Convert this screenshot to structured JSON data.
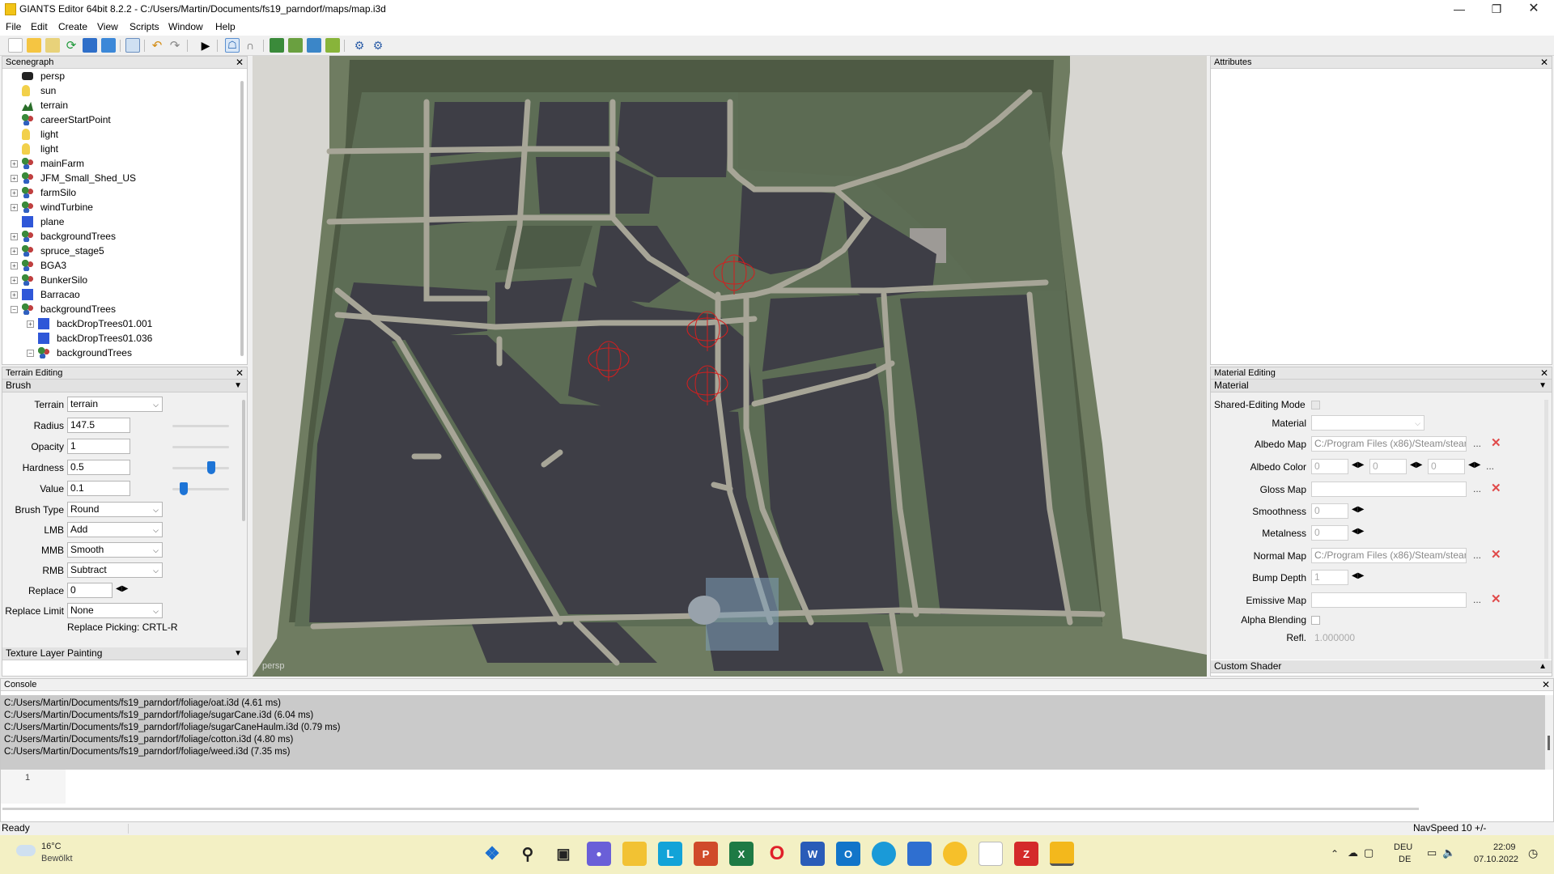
{
  "window": {
    "title": "GIANTS Editor 64bit 8.2.2 - C:/Users/Martin/Documents/fs19_parndorf/maps/map.i3d"
  },
  "menu": [
    "File",
    "Edit",
    "Create",
    "View",
    "Scripts",
    "Window",
    "Help"
  ],
  "scenegraph": {
    "title": "Scenegraph",
    "items": [
      {
        "label": "persp",
        "icon": "camera-icon"
      },
      {
        "label": "sun",
        "icon": "light-bulb-icon"
      },
      {
        "label": "terrain",
        "icon": "terrain-icon"
      },
      {
        "label": "careerStartPoint",
        "icon": "transform-group-icon"
      },
      {
        "label": "light",
        "icon": "light-bulb-icon"
      },
      {
        "label": "light",
        "icon": "light-bulb-icon"
      },
      {
        "label": "mainFarm",
        "icon": "transform-group-icon"
      },
      {
        "label": "JFM_Small_Shed_US",
        "icon": "transform-group-icon"
      },
      {
        "label": "farmSilo",
        "icon": "transform-group-icon"
      },
      {
        "label": "windTurbine",
        "icon": "transform-group-icon"
      },
      {
        "label": "plane",
        "icon": "shape-cube-icon"
      },
      {
        "label": "backgroundTrees",
        "icon": "transform-group-icon"
      },
      {
        "label": "spruce_stage5",
        "icon": "transform-group-icon"
      },
      {
        "label": "BGA3",
        "icon": "transform-group-icon"
      },
      {
        "label": "BunkerSilo",
        "icon": "transform-group-icon"
      },
      {
        "label": "Barracao",
        "icon": "shape-cube-icon"
      },
      {
        "label": "backgroundTrees",
        "icon": "transform-group-icon"
      },
      {
        "label": "backDropTrees01.001",
        "icon": "shape-cube-icon"
      },
      {
        "label": "backDropTrees01.036",
        "icon": "shape-cube-icon"
      },
      {
        "label": "backgroundTrees",
        "icon": "transform-group-icon"
      }
    ]
  },
  "terrain_editing": {
    "title": "Terrain Editing",
    "brush_section": "Brush",
    "terrain_label": "Terrain",
    "terrain_value": "terrain",
    "radius_label": "Radius",
    "radius_value": "147.5",
    "opacity_label": "Opacity",
    "opacity_value": "1",
    "hardness_label": "Hardness",
    "hardness_value": "0.5",
    "value_label": "Value",
    "value_value": "0.1",
    "brush_type_label": "Brush Type",
    "brush_type_value": "Round",
    "lmb_label": "LMB",
    "lmb_value": "Add",
    "mmb_label": "MMB",
    "mmb_value": "Smooth",
    "rmb_label": "RMB",
    "rmb_value": "Subtract",
    "replace_label": "Replace",
    "replace_value": "0",
    "replace_limit_label": "Replace Limit",
    "replace_limit_value": "None",
    "replace_picking": "Replace Picking: CRTL-R",
    "texture_section": "Texture Layer Painting"
  },
  "viewport": {
    "camera_label": "persp"
  },
  "attributes": {
    "title": "Attributes"
  },
  "material_editing": {
    "title": "Material Editing",
    "section": "Material",
    "shared_editing_label": "Shared-Editing Mode",
    "material_label": "Material",
    "albedo_map_label": "Albedo Map",
    "albedo_map_value": "C:/Program Files (x86)/Steam/stean",
    "albedo_color_label": "Albedo Color",
    "albedo_r": "0",
    "albedo_g": "0",
    "albedo_b": "0",
    "gloss_map_label": "Gloss Map",
    "smoothness_label": "Smoothness",
    "smoothness_value": "0",
    "metalness_label": "Metalness",
    "metalness_value": "0",
    "normal_map_label": "Normal Map",
    "normal_map_value": "C:/Program Files (x86)/Steam/stean",
    "bump_depth_label": "Bump Depth",
    "bump_depth_value": "1",
    "emissive_map_label": "Emissive Map",
    "alpha_blending_label": "Alpha Blending",
    "refl_label": "Refl.",
    "refl_value": "1.000000",
    "custom_shader": "Custom Shader"
  },
  "console": {
    "title": "Console",
    "lines": [
      "C:/Users/Martin/Documents/fs19_parndorf/foliage/oat.i3d (4.61 ms)",
      "C:/Users/Martin/Documents/fs19_parndorf/foliage/sugarCane.i3d (6.04 ms)",
      "C:/Users/Martin/Documents/fs19_parndorf/foliage/sugarCaneHaulm.i3d (0.79 ms)",
      "C:/Users/Martin/Documents/fs19_parndorf/foliage/cotton.i3d (4.80 ms)",
      "C:/Users/Martin/Documents/fs19_parndorf/foliage/weed.i3d (7.35 ms)"
    ],
    "line_number": "1"
  },
  "status": {
    "left": "Ready",
    "right": "NavSpeed 10 +/-"
  },
  "taskbar": {
    "temp": "16°C",
    "weather": "Bewölkt",
    "lang_top": "DEU",
    "lang_bottom": "DE",
    "time": "22:09",
    "date": "07.10.2022"
  }
}
